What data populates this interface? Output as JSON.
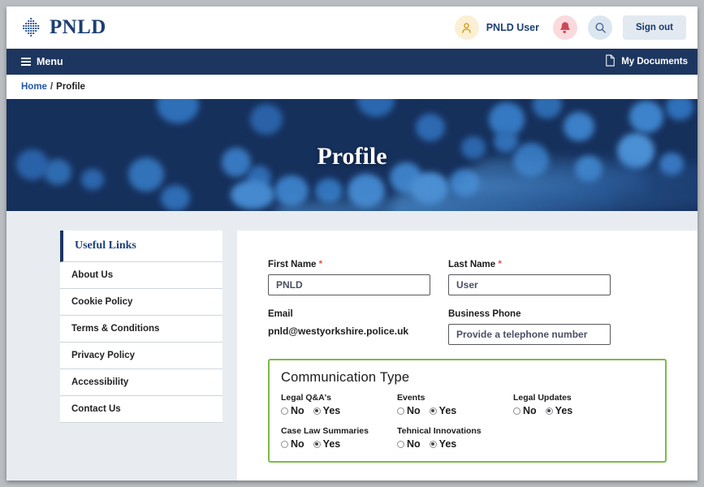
{
  "header": {
    "logo_text": "PNLD",
    "logo_icon": "pnld-dot-matrix-logo",
    "user_icon": "person-icon",
    "user_name": "PNLD User",
    "bell_icon": "notification-bell-icon",
    "search_icon": "search-icon",
    "sign_out_label": "Sign out"
  },
  "navbar": {
    "menu_label": "Menu",
    "menu_icon": "hamburger-menu-icon",
    "my_documents_label": "My Documents",
    "my_documents_icon": "document-page-icon"
  },
  "breadcrumb": {
    "home": "Home",
    "separator": "/",
    "current": "Profile"
  },
  "hero": {
    "title": "Profile"
  },
  "sidebar": {
    "heading": "Useful Links",
    "items": [
      {
        "label": "About Us"
      },
      {
        "label": "Cookie Policy"
      },
      {
        "label": "Terms & Conditions"
      },
      {
        "label": "Privacy Policy"
      },
      {
        "label": "Accessibility"
      },
      {
        "label": "Contact Us"
      }
    ]
  },
  "form": {
    "first_name": {
      "label": "First Name",
      "required_mark": "*",
      "value": "PNLD"
    },
    "last_name": {
      "label": "Last Name",
      "required_mark": "*",
      "value": "User"
    },
    "email": {
      "label": "Email",
      "value": "pnld@westyorkshire.police.uk"
    },
    "business_phone": {
      "label": "Business Phone",
      "value": "",
      "placeholder": "Provide a telephone number"
    }
  },
  "communication": {
    "title": "Communication Type",
    "option_no": "No",
    "option_yes": "Yes",
    "groups": [
      {
        "label": "Legal Q&A's",
        "selected": "Yes"
      },
      {
        "label": "Events",
        "selected": "Yes"
      },
      {
        "label": "Legal Updates",
        "selected": "Yes"
      },
      {
        "label": "Case Law Summaries",
        "selected": "Yes"
      },
      {
        "label": "Tehnical Innovations",
        "selected": "Yes"
      }
    ]
  },
  "colors": {
    "navy": "#1d3660",
    "brand_blue": "#1c3f72",
    "link_blue": "#2256a8",
    "required_red": "#e2574c",
    "green_border": "#7cbb48",
    "page_bg": "#e8ecf1"
  }
}
